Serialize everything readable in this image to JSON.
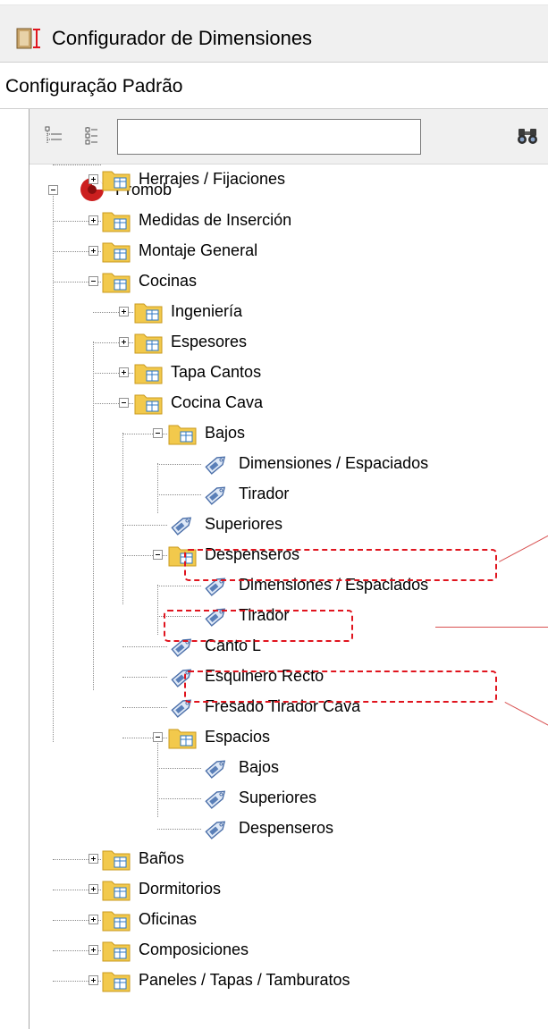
{
  "window": {
    "title": "Configurador de Dimensiones",
    "icon": "ruler-book-icon"
  },
  "config": {
    "label": "Configuração Padrão"
  },
  "toolbar": {
    "buttons": [
      "collapse-tree-icon",
      "expand-tree-icon"
    ],
    "search_value": "",
    "find_icon": "binoculars-icon"
  },
  "colors": {
    "highlight": "#e0141e",
    "folder": "#f2c94c",
    "tag": "#5a7fb8",
    "root": "#cc1f1f"
  },
  "tree": {
    "root": "Promob",
    "nodes": [
      {
        "label": "Medidas de Inserción",
        "type": "folder",
        "state": "collapsed"
      },
      {
        "label": "Montaje General",
        "type": "folder",
        "state": "collapsed"
      },
      {
        "label": "Cocinas",
        "type": "folder",
        "state": "expanded"
      },
      {
        "label": "Ingeniería",
        "type": "folder",
        "state": "collapsed"
      },
      {
        "label": "Espesores",
        "type": "folder",
        "state": "collapsed"
      },
      {
        "label": "Tapa Cantos",
        "type": "folder",
        "state": "collapsed"
      },
      {
        "label": "Cocina Cava",
        "type": "folder",
        "state": "expanded"
      },
      {
        "label": "Bajos",
        "type": "folder",
        "state": "expanded"
      },
      {
        "label": "Dimensiones / Espaciados",
        "type": "item",
        "highlighted": true
      },
      {
        "label": "Tirador",
        "type": "item"
      },
      {
        "label": "Superiores",
        "type": "item",
        "highlighted": true
      },
      {
        "label": "Despenseros",
        "type": "folder",
        "state": "expanded"
      },
      {
        "label": "Dimensiones / Espaciados",
        "type": "item",
        "highlighted": true
      },
      {
        "label": "Tirador",
        "type": "item"
      },
      {
        "label": "Canto L",
        "type": "item"
      },
      {
        "label": "Esquinero Recto",
        "type": "item"
      },
      {
        "label": "Fresado Tirador Cava",
        "type": "item"
      },
      {
        "label": "Espacios",
        "type": "folder",
        "state": "expanded"
      },
      {
        "label": "Bajos",
        "type": "item"
      },
      {
        "label": "Superiores",
        "type": "item"
      },
      {
        "label": "Despenseros",
        "type": "item"
      },
      {
        "label": "Baños",
        "type": "folder",
        "state": "collapsed"
      },
      {
        "label": "Dormitorios",
        "type": "folder",
        "state": "collapsed"
      },
      {
        "label": "Oficinas",
        "type": "folder",
        "state": "collapsed"
      },
      {
        "label": "Composiciones",
        "type": "folder",
        "state": "collapsed"
      },
      {
        "label": "Paneles / Tapas / Tamburatos",
        "type": "folder",
        "state": "collapsed"
      },
      {
        "label": "Herrajes / Fijaciones",
        "type": "folder",
        "state": "collapsed"
      }
    ]
  }
}
